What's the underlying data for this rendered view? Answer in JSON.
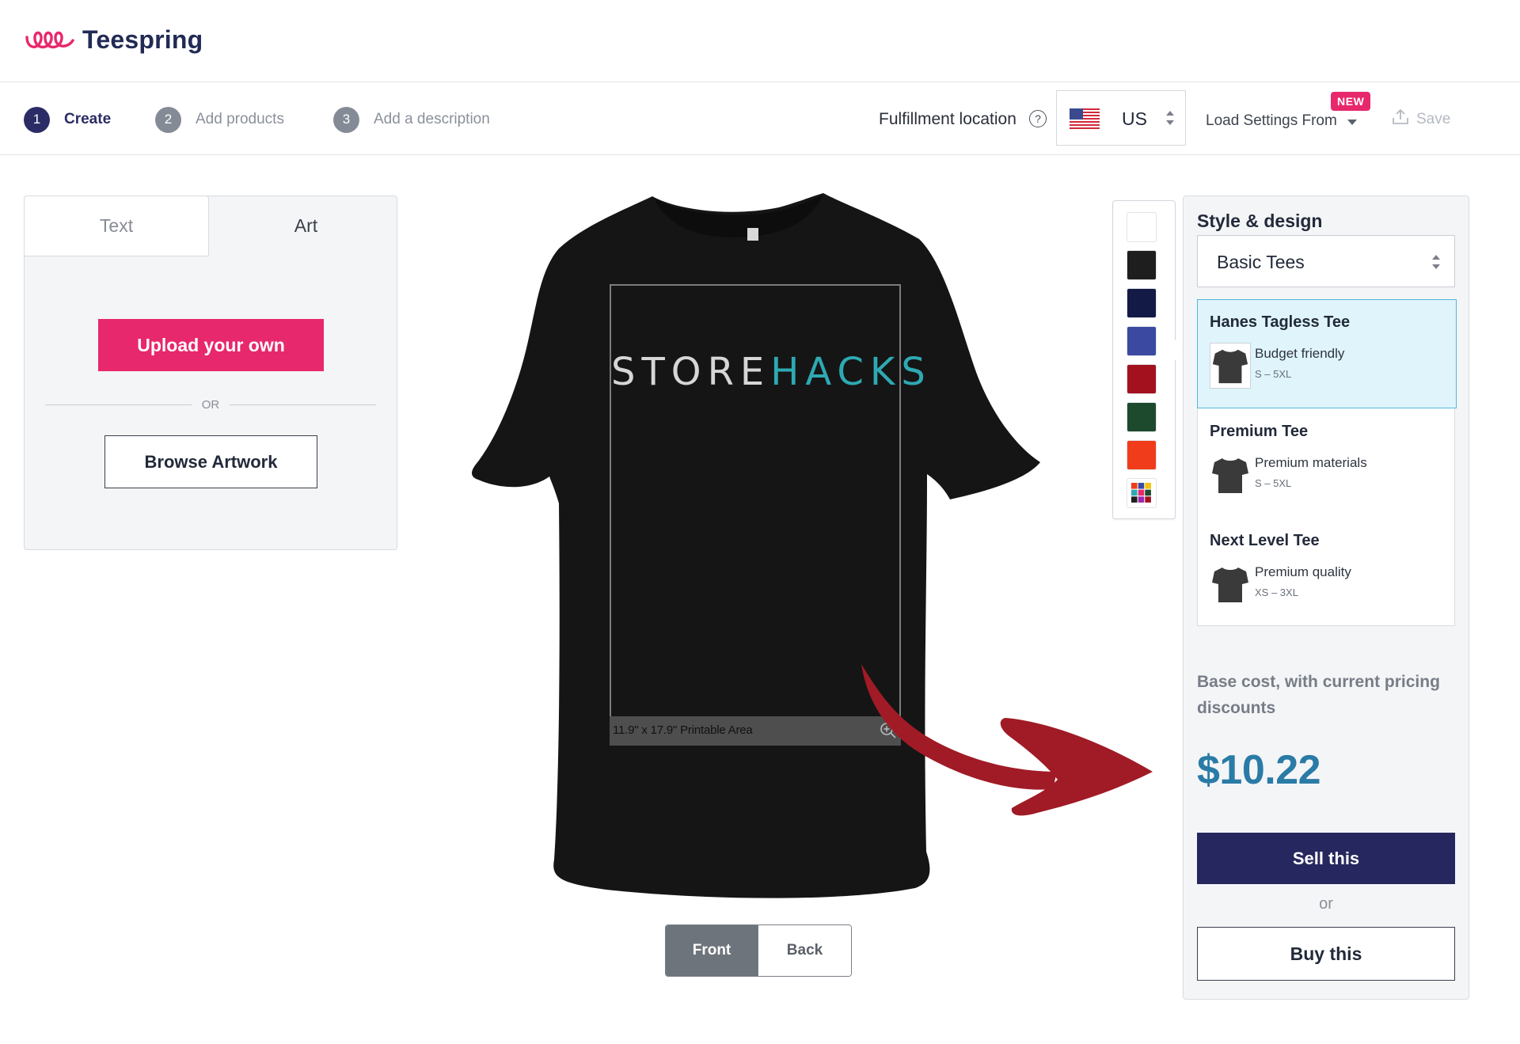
{
  "brand": {
    "name": "Teespring",
    "accent": "#e8286c",
    "navy": "#26275e"
  },
  "steps": [
    {
      "number": "1",
      "label": "Create",
      "active": true
    },
    {
      "number": "2",
      "label": "Add products",
      "active": false
    },
    {
      "number": "3",
      "label": "Add a description",
      "active": false
    }
  ],
  "fulfillment": {
    "label": "Fulfillment location",
    "country": "US",
    "help_icon": "question-circle-icon",
    "flag_icon": "us-flag-icon"
  },
  "load_settings": {
    "label": "Load Settings From",
    "badge": "NEW"
  },
  "save": {
    "label": "Save",
    "icon": "save-upload-icon"
  },
  "left_panel": {
    "tabs": [
      {
        "label": "Text"
      },
      {
        "label": "Art"
      }
    ],
    "upload_label": "Upload your own",
    "or_label": "OR",
    "browse_label": "Browse Artwork"
  },
  "canvas": {
    "design_text_part1": "STORE",
    "design_text_part2": "HACKS",
    "printable_area_label": "11.9\" x 17.9\" Printable Area",
    "zoom_icon": "zoom-in-icon",
    "views": {
      "front": "Front",
      "back": "Back",
      "selected": "Front"
    }
  },
  "colors": [
    {
      "name": "white",
      "hex": "#ffffff"
    },
    {
      "name": "black",
      "hex": "#1e1e1e"
    },
    {
      "name": "navy",
      "hex": "#131a45"
    },
    {
      "name": "royal",
      "hex": "#3b4aa0"
    },
    {
      "name": "red",
      "hex": "#a3111f"
    },
    {
      "name": "forest",
      "hex": "#1d4a2c"
    },
    {
      "name": "orange",
      "hex": "#f03c1a"
    },
    {
      "name": "more-colors",
      "hex": "multi"
    }
  ],
  "style_panel": {
    "title": "Style & design",
    "category": "Basic Tees",
    "products": [
      {
        "name": "Hanes Tagless Tee",
        "desc": "Budget friendly",
        "sizes": "S – 5XL",
        "selected": true
      },
      {
        "name": "Premium Tee",
        "desc": "Premium materials",
        "sizes": "S – 5XL",
        "selected": false
      },
      {
        "name": "Next Level Tee",
        "desc": "Premium quality",
        "sizes": "XS – 3XL",
        "selected": false
      }
    ],
    "base_cost_label": "Base cost, with current pricing discounts",
    "price": "$10.22",
    "sell_label": "Sell this",
    "or_label": "or",
    "buy_label": "Buy this"
  }
}
